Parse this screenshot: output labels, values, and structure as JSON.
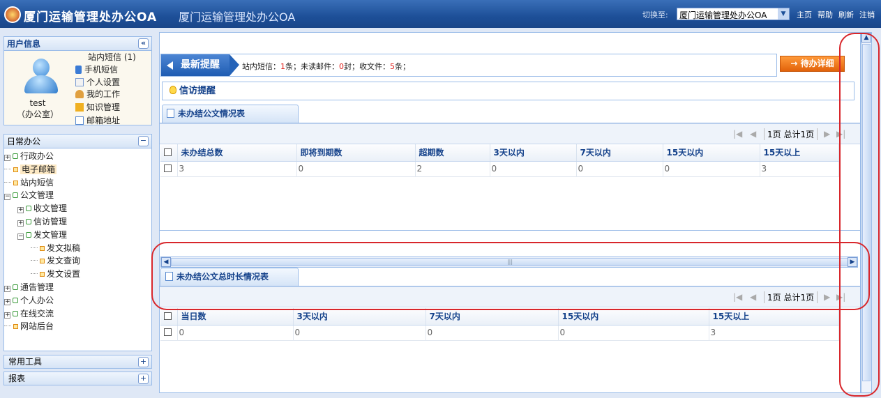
{
  "header": {
    "brand": "厦门运输管理处办公OA",
    "subtitle": "厦门运输管理处办公OA",
    "switch_label": "切换至:",
    "switch_selected": "厦门运输管理处办公OA",
    "links": [
      "主页",
      "帮助",
      "刷新",
      "注销"
    ]
  },
  "user_panel": {
    "title": "用户信息",
    "name": "test",
    "dept": "（办公室）",
    "menu": [
      "站内短信 (1)",
      "手机短信",
      "个人设置",
      "我的工作",
      "知识管理",
      "邮箱地址"
    ]
  },
  "nav_panel": {
    "title": "日常办公",
    "tree": [
      {
        "label": "行政办公",
        "level": 0,
        "type": "folder",
        "expand": "+"
      },
      {
        "label": "电子邮箱",
        "level": 0,
        "type": "leaf",
        "selected": true
      },
      {
        "label": "站内短信",
        "level": 0,
        "type": "leaf"
      },
      {
        "label": "公文管理",
        "level": 0,
        "type": "folder",
        "expand": "−"
      },
      {
        "label": "收文管理",
        "level": 1,
        "type": "folder",
        "expand": "+"
      },
      {
        "label": "信访管理",
        "level": 1,
        "type": "folder",
        "expand": "+"
      },
      {
        "label": "发文管理",
        "level": 1,
        "type": "folder",
        "expand": "−"
      },
      {
        "label": "发文拟稿",
        "level": 2,
        "type": "leaf"
      },
      {
        "label": "发文查询",
        "level": 2,
        "type": "leaf"
      },
      {
        "label": "发文设置",
        "level": 2,
        "type": "leaf"
      },
      {
        "label": "通告管理",
        "level": 0,
        "type": "folder",
        "expand": "+"
      },
      {
        "label": "个人办公",
        "level": 0,
        "type": "folder",
        "expand": "+"
      },
      {
        "label": "在线交流",
        "level": 0,
        "type": "folder",
        "expand": "+"
      },
      {
        "label": "网站后台",
        "level": 0,
        "type": "leaf"
      }
    ]
  },
  "accordions": [
    "常用工具",
    "报表"
  ],
  "alert": {
    "tag": "最新提醒",
    "seg1": "站内短信：",
    "sms_count": "1",
    "seg2": "条；未读邮件：",
    "mail_count": "0",
    "seg3": "封；收文件：",
    "doc_count": "5",
    "seg4": "条；",
    "button": "→ 待办详细"
  },
  "xinfang": {
    "title": "信访提醒"
  },
  "table1": {
    "tab": "未办结公文情况表",
    "pager": "1页 总计1页",
    "headers": [
      "未办结总数",
      "即将到期数",
      "超期数",
      "3天以内",
      "7天以内",
      "15天以内",
      "15天以上"
    ],
    "rows": [
      [
        "3",
        "0",
        "2",
        "0",
        "0",
        "0",
        "3"
      ]
    ]
  },
  "table2": {
    "tab": "未办结公文总时长情况表",
    "pager": "1页 总计1页",
    "headers": [
      "当日数",
      "3天以内",
      "7天以内",
      "15天以内",
      "15天以上"
    ],
    "rows": [
      [
        "0",
        "0",
        "0",
        "0",
        "3"
      ]
    ]
  },
  "colors": {
    "accent": "#1d4f98",
    "highlight": "#e0201b",
    "button": "#f07a1a",
    "annotation": "#d8262b"
  }
}
